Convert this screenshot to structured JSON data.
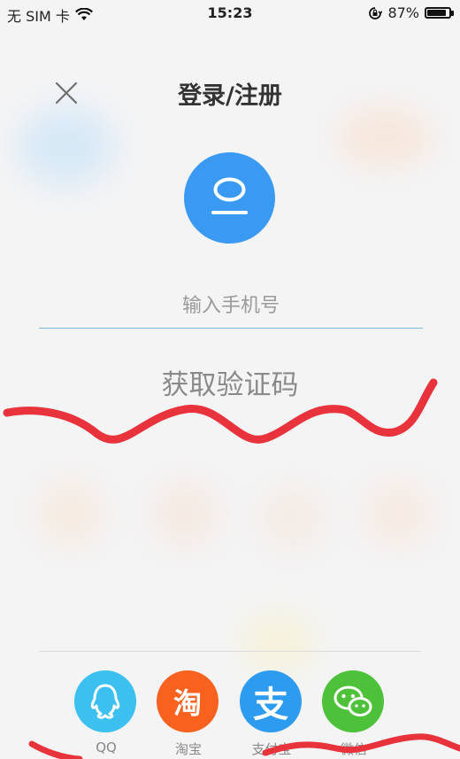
{
  "status_bar": {
    "carrier": "无 SIM 卡",
    "time": "15:23",
    "battery_percent": "87%",
    "battery_level": 0.87
  },
  "header": {
    "title": "登录/注册"
  },
  "login_form": {
    "phone_placeholder": "输入手机号",
    "get_code_label": "获取验证码"
  },
  "social_login": [
    {
      "label": "QQ",
      "color": "#3cc0f0",
      "icon": "qq-penguin-icon"
    },
    {
      "label": "淘宝",
      "glyph": "淘",
      "color": "#f8611e",
      "icon": "taobao-icon"
    },
    {
      "label": "支付宝",
      "glyph": "支",
      "color": "#2d9cf0",
      "icon": "alipay-icon"
    },
    {
      "label": "微信",
      "color": "#4ec13a",
      "icon": "wechat-icon"
    }
  ],
  "colors": {
    "avatar_blue": "#3a9af3",
    "scribble_red": "#e8323c"
  }
}
